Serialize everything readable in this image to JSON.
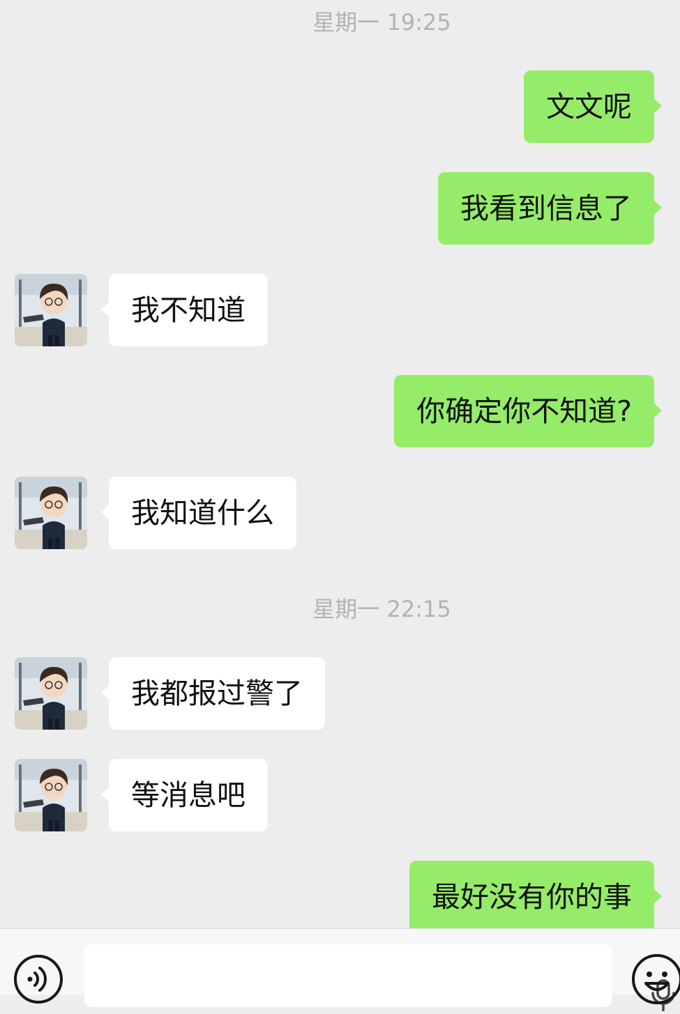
{
  "colors": {
    "background": "#ededed",
    "outgoing_bubble": "#95ec69",
    "incoming_bubble": "#ffffff",
    "timestamp_text": "#b2b2b2"
  },
  "timestamps": [
    "星期一 19:25",
    "星期一 22:15"
  ],
  "messages": [
    {
      "sender": "me",
      "text": "文文呢"
    },
    {
      "sender": "me",
      "text": "我看到信息了"
    },
    {
      "sender": "contact",
      "text": "我不知道"
    },
    {
      "sender": "me",
      "text": "你确定你不知道?"
    },
    {
      "sender": "contact",
      "text": "我知道什么"
    },
    {
      "sender": "contact",
      "text": "我都报过警了"
    },
    {
      "sender": "contact",
      "text": "等消息吧"
    },
    {
      "sender": "me",
      "text": "最好没有你的事"
    }
  ],
  "input_bar": {
    "left_icon": "voice-icon",
    "right_icon": "emoji-icon",
    "field_icon": "microphone-icon",
    "input_value": ""
  }
}
